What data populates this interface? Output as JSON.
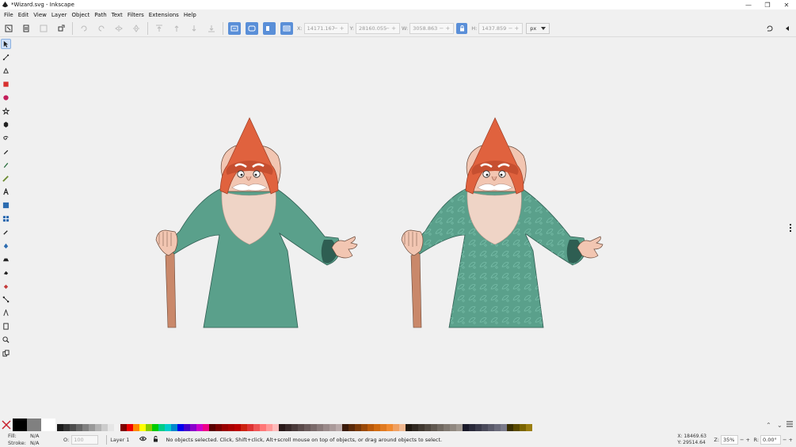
{
  "window": {
    "title": "*Wizard.svg - Inkscape"
  },
  "menu": [
    "File",
    "Edit",
    "View",
    "Layer",
    "Object",
    "Path",
    "Text",
    "Filters",
    "Extensions",
    "Help"
  ],
  "toolbar": {
    "x_label": "X:",
    "x_value": "14171.167",
    "y_label": "Y:",
    "y_value": "28160.055",
    "w_label": "W:",
    "w_value": "3058.863",
    "h_label": "H:",
    "h_value": "1437.859",
    "unit": "px"
  },
  "status": {
    "fill_label": "Fill:",
    "fill_value": "N/A",
    "stroke_label": "Stroke:",
    "stroke_value": "N/A",
    "opacity_label": "O:",
    "opacity_value": "100",
    "layer": "Layer 1",
    "message": "No objects selected. Click, Shift+click, Alt+scroll mouse on top of objects, or drag around objects to select.",
    "cursor_x": "X:  18469.63",
    "cursor_y": "Y:  29514.64",
    "zoom_label": "Z:",
    "zoom_value": "35%",
    "rotation_label": "R:",
    "rotation_value": "0.00°"
  },
  "colors": {
    "accent": "#5a8fd8",
    "wizard_robe": "#5aa08b",
    "wizard_hat": "#e0623e",
    "staff": "#c9886a",
    "skin": "#f2c6b2"
  }
}
